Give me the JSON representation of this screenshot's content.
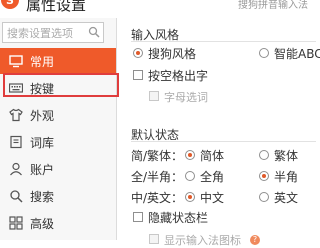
{
  "window": {
    "title": "属性设置",
    "hint": "搜狗拼音输入法"
  },
  "sidebar": {
    "search_placeholder": "搜索设置选项",
    "items": [
      {
        "label": "常用",
        "icon": "monitor-icon",
        "active": true
      },
      {
        "label": "按键",
        "icon": "keyboard-icon",
        "active": false
      },
      {
        "label": "外观",
        "icon": "shirt-icon",
        "active": false
      },
      {
        "label": "词库",
        "icon": "book-icon",
        "active": false
      },
      {
        "label": "账户",
        "icon": "user-icon",
        "active": false
      },
      {
        "label": "搜索",
        "icon": "magnifier-icon",
        "active": false
      },
      {
        "label": "高级",
        "icon": "grid-icon",
        "active": false
      }
    ]
  },
  "input_style": {
    "title": "输入风格",
    "sogou_style": "搜狗风格",
    "smart_abc_style": "智能ABC风",
    "selected": "sogou",
    "space_output": "按空格出字",
    "letter_select": "字母选词"
  },
  "default_state": {
    "title": "默认状态",
    "trad_label": "简/繁体：",
    "trad_opt1": "简体",
    "trad_opt2": "繁体",
    "trad_selected": "simplified",
    "width_label": "全/半角：",
    "width_opt1": "全角",
    "width_opt2": "半角",
    "width_selected": "half",
    "lang_label": "中/英文：",
    "lang_opt1": "中文",
    "lang_opt2": "英文",
    "lang_selected": "chinese",
    "hide_status": "隐藏状态栏",
    "partial_text": "显示输入法图标",
    "partial_q": "?"
  },
  "colors": {
    "accent": "#ef5a2a",
    "highlight_box": "#e03d3d"
  }
}
